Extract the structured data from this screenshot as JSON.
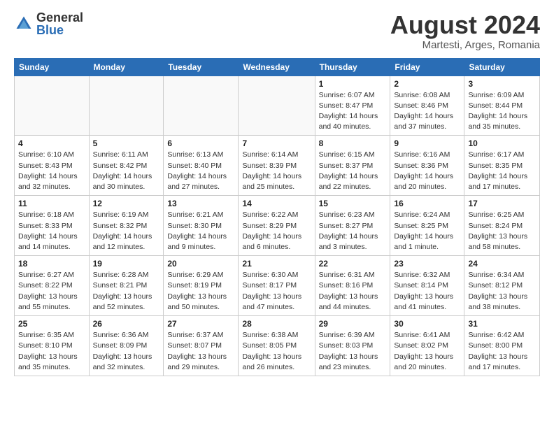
{
  "logo": {
    "general": "General",
    "blue": "Blue"
  },
  "title": "August 2024",
  "subtitle": "Martesti, Arges, Romania",
  "headers": [
    "Sunday",
    "Monday",
    "Tuesday",
    "Wednesday",
    "Thursday",
    "Friday",
    "Saturday"
  ],
  "weeks": [
    [
      {
        "day": "",
        "detail": ""
      },
      {
        "day": "",
        "detail": ""
      },
      {
        "day": "",
        "detail": ""
      },
      {
        "day": "",
        "detail": ""
      },
      {
        "day": "1",
        "detail": "Sunrise: 6:07 AM\nSunset: 8:47 PM\nDaylight: 14 hours\nand 40 minutes."
      },
      {
        "day": "2",
        "detail": "Sunrise: 6:08 AM\nSunset: 8:46 PM\nDaylight: 14 hours\nand 37 minutes."
      },
      {
        "day": "3",
        "detail": "Sunrise: 6:09 AM\nSunset: 8:44 PM\nDaylight: 14 hours\nand 35 minutes."
      }
    ],
    [
      {
        "day": "4",
        "detail": "Sunrise: 6:10 AM\nSunset: 8:43 PM\nDaylight: 14 hours\nand 32 minutes."
      },
      {
        "day": "5",
        "detail": "Sunrise: 6:11 AM\nSunset: 8:42 PM\nDaylight: 14 hours\nand 30 minutes."
      },
      {
        "day": "6",
        "detail": "Sunrise: 6:13 AM\nSunset: 8:40 PM\nDaylight: 14 hours\nand 27 minutes."
      },
      {
        "day": "7",
        "detail": "Sunrise: 6:14 AM\nSunset: 8:39 PM\nDaylight: 14 hours\nand 25 minutes."
      },
      {
        "day": "8",
        "detail": "Sunrise: 6:15 AM\nSunset: 8:37 PM\nDaylight: 14 hours\nand 22 minutes."
      },
      {
        "day": "9",
        "detail": "Sunrise: 6:16 AM\nSunset: 8:36 PM\nDaylight: 14 hours\nand 20 minutes."
      },
      {
        "day": "10",
        "detail": "Sunrise: 6:17 AM\nSunset: 8:35 PM\nDaylight: 14 hours\nand 17 minutes."
      }
    ],
    [
      {
        "day": "11",
        "detail": "Sunrise: 6:18 AM\nSunset: 8:33 PM\nDaylight: 14 hours\nand 14 minutes."
      },
      {
        "day": "12",
        "detail": "Sunrise: 6:19 AM\nSunset: 8:32 PM\nDaylight: 14 hours\nand 12 minutes."
      },
      {
        "day": "13",
        "detail": "Sunrise: 6:21 AM\nSunset: 8:30 PM\nDaylight: 14 hours\nand 9 minutes."
      },
      {
        "day": "14",
        "detail": "Sunrise: 6:22 AM\nSunset: 8:29 PM\nDaylight: 14 hours\nand 6 minutes."
      },
      {
        "day": "15",
        "detail": "Sunrise: 6:23 AM\nSunset: 8:27 PM\nDaylight: 14 hours\nand 3 minutes."
      },
      {
        "day": "16",
        "detail": "Sunrise: 6:24 AM\nSunset: 8:25 PM\nDaylight: 14 hours\nand 1 minute."
      },
      {
        "day": "17",
        "detail": "Sunrise: 6:25 AM\nSunset: 8:24 PM\nDaylight: 13 hours\nand 58 minutes."
      }
    ],
    [
      {
        "day": "18",
        "detail": "Sunrise: 6:27 AM\nSunset: 8:22 PM\nDaylight: 13 hours\nand 55 minutes."
      },
      {
        "day": "19",
        "detail": "Sunrise: 6:28 AM\nSunset: 8:21 PM\nDaylight: 13 hours\nand 52 minutes."
      },
      {
        "day": "20",
        "detail": "Sunrise: 6:29 AM\nSunset: 8:19 PM\nDaylight: 13 hours\nand 50 minutes."
      },
      {
        "day": "21",
        "detail": "Sunrise: 6:30 AM\nSunset: 8:17 PM\nDaylight: 13 hours\nand 47 minutes."
      },
      {
        "day": "22",
        "detail": "Sunrise: 6:31 AM\nSunset: 8:16 PM\nDaylight: 13 hours\nand 44 minutes."
      },
      {
        "day": "23",
        "detail": "Sunrise: 6:32 AM\nSunset: 8:14 PM\nDaylight: 13 hours\nand 41 minutes."
      },
      {
        "day": "24",
        "detail": "Sunrise: 6:34 AM\nSunset: 8:12 PM\nDaylight: 13 hours\nand 38 minutes."
      }
    ],
    [
      {
        "day": "25",
        "detail": "Sunrise: 6:35 AM\nSunset: 8:10 PM\nDaylight: 13 hours\nand 35 minutes."
      },
      {
        "day": "26",
        "detail": "Sunrise: 6:36 AM\nSunset: 8:09 PM\nDaylight: 13 hours\nand 32 minutes."
      },
      {
        "day": "27",
        "detail": "Sunrise: 6:37 AM\nSunset: 8:07 PM\nDaylight: 13 hours\nand 29 minutes."
      },
      {
        "day": "28",
        "detail": "Sunrise: 6:38 AM\nSunset: 8:05 PM\nDaylight: 13 hours\nand 26 minutes."
      },
      {
        "day": "29",
        "detail": "Sunrise: 6:39 AM\nSunset: 8:03 PM\nDaylight: 13 hours\nand 23 minutes."
      },
      {
        "day": "30",
        "detail": "Sunrise: 6:41 AM\nSunset: 8:02 PM\nDaylight: 13 hours\nand 20 minutes."
      },
      {
        "day": "31",
        "detail": "Sunrise: 6:42 AM\nSunset: 8:00 PM\nDaylight: 13 hours\nand 17 minutes."
      }
    ]
  ]
}
